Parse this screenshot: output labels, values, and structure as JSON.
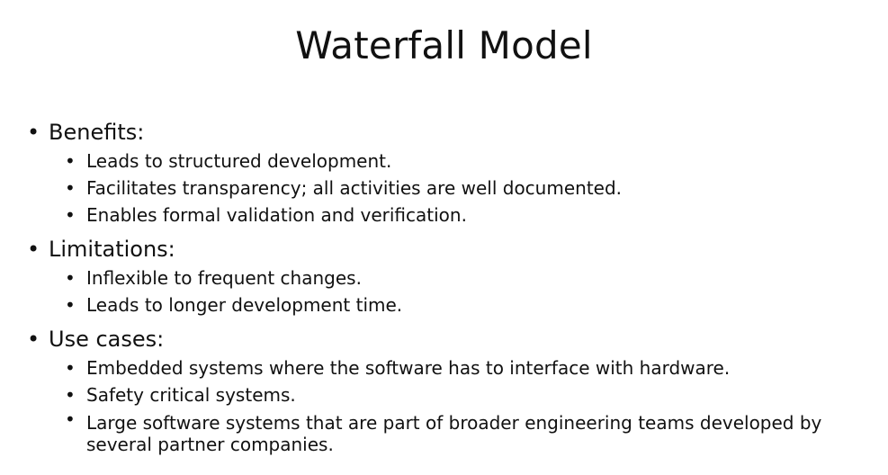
{
  "slide": {
    "title": "Waterfall Model",
    "bullet_char": "•",
    "sections": [
      {
        "heading": "Benefits:",
        "items": [
          "Leads to structured development.",
          "Facilitates transparency; all activities are well documented.",
          "Enables formal validation and verification."
        ]
      },
      {
        "heading": "Limitations:",
        "items": [
          "Inflexible to frequent changes.",
          "Leads to longer development time."
        ]
      },
      {
        "heading": "Use cases:",
        "items": [
          "Embedded systems where the software has to interface with hardware.",
          "Safety critical systems.",
          "Large software systems that are part of broader engineering teams developed by several partner companies."
        ]
      }
    ]
  }
}
